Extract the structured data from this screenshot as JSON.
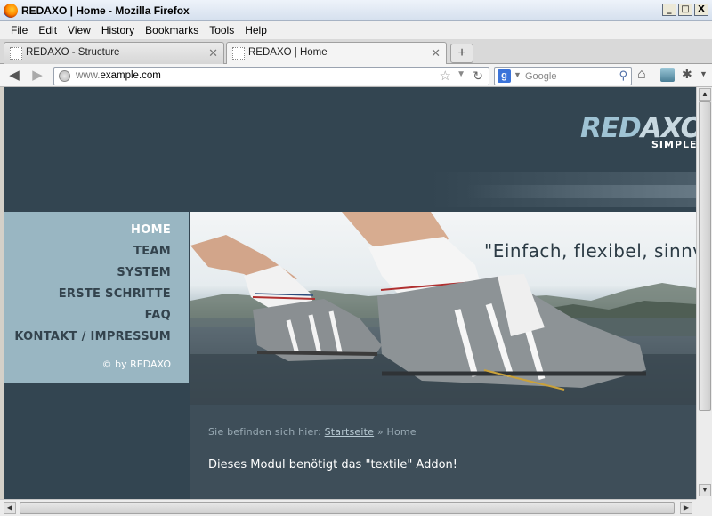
{
  "window": {
    "title": "REDAXO | Home - Mozilla Firefox",
    "controls": [
      "_",
      "□",
      "X"
    ]
  },
  "menu": {
    "items": [
      {
        "label": "File"
      },
      {
        "label": "Edit"
      },
      {
        "label": "View"
      },
      {
        "label": "History"
      },
      {
        "label": "Bookmarks"
      },
      {
        "label": "Tools"
      },
      {
        "label": "Help"
      }
    ]
  },
  "tabs": [
    {
      "label": "REDAXO - Structure",
      "active": false
    },
    {
      "label": "REDAXO | Home",
      "active": true
    }
  ],
  "navbar": {
    "url_prefix": "www.",
    "url_domain": "example.com",
    "search_placeholder": "Google",
    "search_engine_icon": "g"
  },
  "site": {
    "logo_red": "RED",
    "logo_axo": "AXO",
    "slogan": "SIMPLE I",
    "nav": [
      {
        "label": "HOME",
        "active": true
      },
      {
        "label": "TEAM",
        "active": false
      },
      {
        "label": "SYSTEM",
        "active": false
      },
      {
        "label": "ERSTE SCHRITTE",
        "active": false
      },
      {
        "label": "FAQ",
        "active": false
      },
      {
        "label": "KONTAKT / IMPRESSUM",
        "active": false
      }
    ],
    "copyright": "© by REDAXO",
    "banner_quote": "\"Einfach, flexibel, sinnv",
    "breadcrumb": {
      "prefix": "Sie befinden sich hier:",
      "link": "Startseite",
      "separator": "»",
      "current": "Home"
    },
    "content_text": "Dieses Modul benötigt das \"textile\" Addon!"
  },
  "colors": {
    "header_bg": "#334551",
    "sidebar_bg": "#99b6c2",
    "content_bg": "#3e4e59",
    "nav_active": "#ffffff",
    "nav_text": "#33434d"
  }
}
